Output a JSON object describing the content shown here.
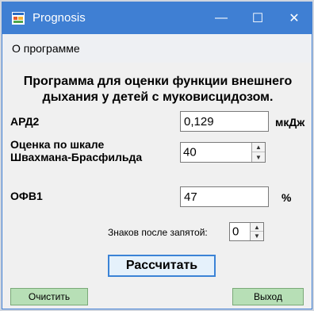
{
  "window": {
    "title": "Prognosis",
    "controls": {
      "minimize": "—",
      "maximize": "☐",
      "close": "✕"
    }
  },
  "menu": {
    "items": [
      {
        "label": "О программе"
      }
    ]
  },
  "form": {
    "heading_line1": "Программа для оценки функции внешнего",
    "heading_line2": "дыхания у детей с муковисцидозом.",
    "ard2": {
      "label": "АРД2",
      "value": "0,129",
      "unit": "мкДж"
    },
    "shwachman": {
      "label_line1": "Оценка по шкале",
      "label_line2": "Швахмана-Брасфильда",
      "value": "40"
    },
    "ofv1": {
      "label": "ОФВ1",
      "value": "47",
      "unit": "%"
    },
    "decimals": {
      "label": "Знаков после запятой:",
      "value": "0"
    },
    "calculate_label": "Рассчитать",
    "clear_label": "Очистить",
    "exit_label": "Выход"
  },
  "colors": {
    "titlebar": "#3f7fd3",
    "green_button": "#b7dfb6",
    "calc_button_border": "#3b83d6"
  }
}
